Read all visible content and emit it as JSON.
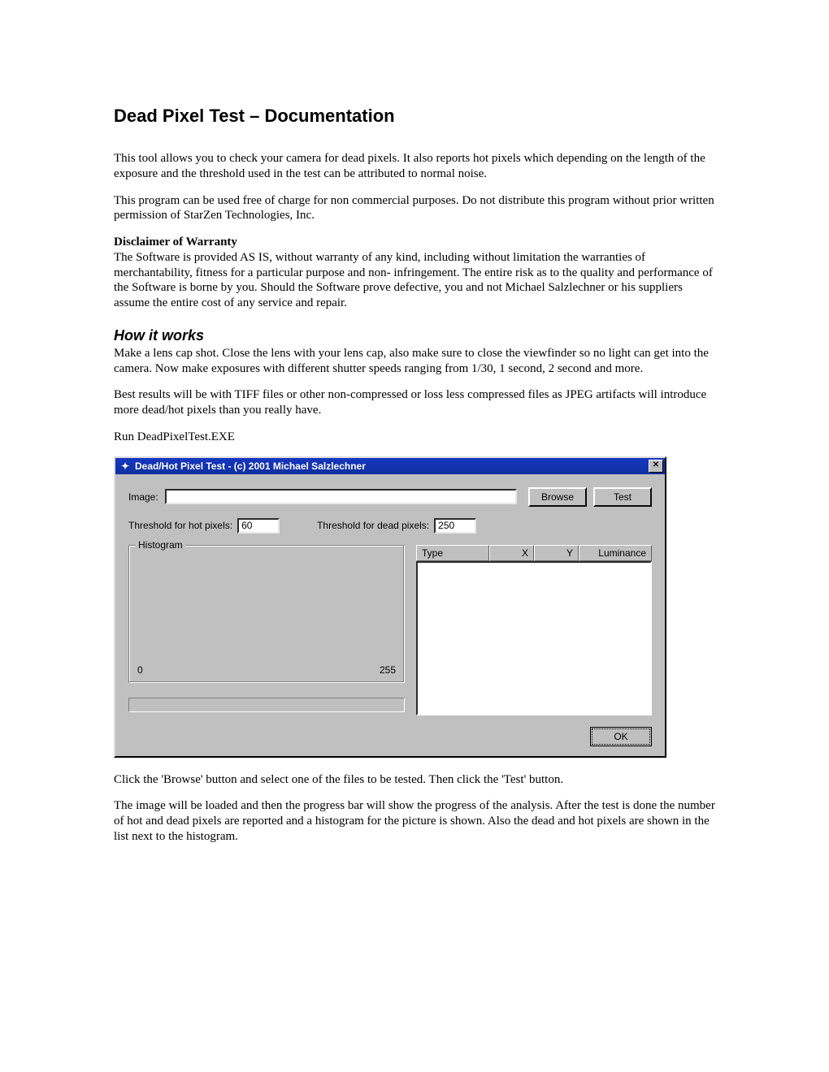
{
  "doc": {
    "title": "Dead Pixel Test – Documentation",
    "intro1": "This tool allows you to check your camera for dead pixels. It also reports hot pixels which depending on the length of the exposure and the threshold used in the test can be attributed to normal noise.",
    "intro2": "This program can be used free of charge for non commercial purposes. Do not distribute this program without prior written permission of StarZen Technologies, Inc.",
    "disclaimer_heading": "Disclaimer of Warranty",
    "disclaimer_body": "The Software is provided AS IS, without warranty of any kind, including without limitation the warranties of merchantability, fitness for a particular purpose and non- infringement. The entire risk as to the quality and performance of the Software is borne by you. Should the Software prove defective, you and not Michael Salzlechner or his suppliers assume the entire cost of any service and repair.",
    "how_heading": "How it works",
    "how_p1": "Make a lens cap shot. Close the lens with your lens cap, also make sure to close the viewfinder so no light can get into the camera. Now make exposures with different shutter speeds ranging from 1/30, 1 second, 2 second and more.",
    "how_p2": "Best results will be with TIFF files or other non-compressed or loss less compressed files as JPEG artifacts will introduce more dead/hot pixels than you really have.",
    "run_line": "Run DeadPixelTest.EXE",
    "after_p1": "Click the 'Browse' button and select one of the files to be tested.  Then click the 'Test' button.",
    "after_p2": "The image will be loaded and then the progress bar will show the progress of the analysis. After the test is done the number of hot and dead pixels are reported and a histogram for the picture is shown. Also the dead and hot pixels are shown in the list next to the histogram."
  },
  "window": {
    "title": "Dead/Hot Pixel Test - (c) 2001 Michael Salzlechner",
    "close_glyph": "✕",
    "image_label": "Image:",
    "image_value": "",
    "browse_label": "Browse",
    "test_label": "Test",
    "threshold_hot_label": "Threshold for hot pixels:",
    "threshold_hot_value": "60",
    "threshold_dead_label": "Threshold for dead pixels:",
    "threshold_dead_value": "250",
    "histogram_legend": "Histogram",
    "hist_min": "0",
    "hist_max": "255",
    "columns": {
      "type": "Type",
      "x": "X",
      "y": "Y",
      "lum": "Luminance"
    },
    "ok_label": "OK",
    "app_icon_glyph": "✦"
  }
}
